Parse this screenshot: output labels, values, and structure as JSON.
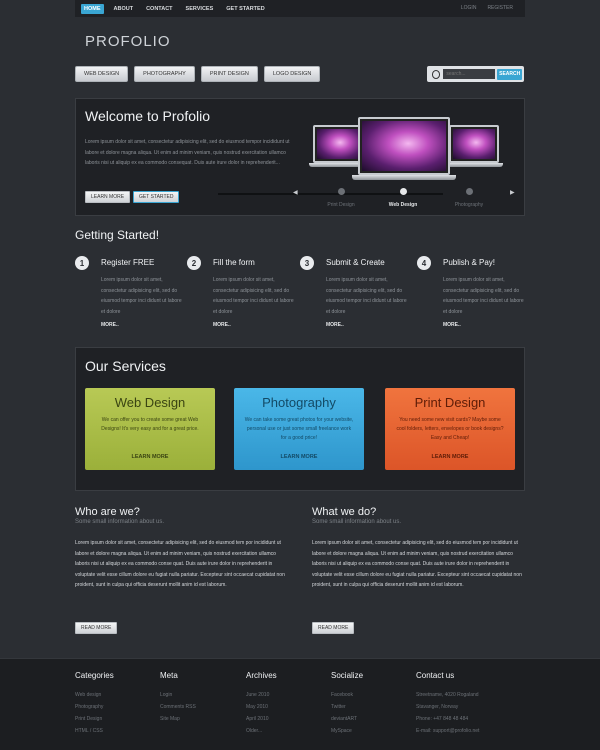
{
  "topnav": {
    "items": [
      "HOME",
      "ABOUT",
      "CONTACT",
      "SERVICES",
      "GET STARTED"
    ],
    "login": "LOGIN",
    "register": "REGISTER"
  },
  "logo": "PROFOLIO",
  "categories": [
    "WEB DESIGN",
    "PHOTOGRAPHY",
    "PRINT DESIGN",
    "LOGO DESIGN"
  ],
  "search": {
    "placeholder": "search...",
    "button": "SEARCH"
  },
  "hero": {
    "title": "Welcome to Profolio",
    "text": "Lorem ipsum dolor sit amet, consectetur adipisicing elit, sed do eiusmod tempor incididunt ut labore et dolore magna aliqua. Ut enim ad minim veniam, quis nostrud exercitation ullamco laboris nisi ut aliquip ex ea commodo consequat. Duis aute irure dolor in reprehenderit...",
    "learn_more": "LEARN MORE",
    "get_started": "GET STARTED",
    "slides": [
      "Print Design",
      "Web Design",
      "Photography"
    ],
    "active_slide": "Web Design"
  },
  "getting_started": {
    "title": "Getting Started!",
    "steps": [
      {
        "num": "1",
        "title": "Register FREE",
        "text": "Lorem ipsum dolor sit amet, consectetur adipisicing elit, sed do eiusmod tempor inci didunt ut labore et dolore",
        "more": "MORE.."
      },
      {
        "num": "2",
        "title": "Fill the form",
        "text": "Lorem ipsum dolor sit amet, consectetur adipisicing elit, sed do eiusmod tempor inci didunt ut labore et dolore",
        "more": "MORE.."
      },
      {
        "num": "3",
        "title": "Submit & Create",
        "text": "Lorem ipsum dolor sit amet, consectetur adipisicing elit, sed do eiusmod tempor inci didunt ut labore et dolore",
        "more": "MORE.."
      },
      {
        "num": "4",
        "title": "Publish & Pay!",
        "text": "Lorem ipsum dolor sit amet, consectetur adipisicing elit, sed do eiusmod tempor inci didunt ut labore et dolore",
        "more": "MORE.."
      }
    ]
  },
  "services": {
    "title": "Our Services",
    "cards": [
      {
        "title": "Web Design",
        "text": "We can offer you to create some great Web Designs! It's very easy and for a great price.",
        "more": "LEARN MORE",
        "color": "#aabd47"
      },
      {
        "title": "Photography",
        "text": "We can take some great photos for your website, personal use or just some small freelance work for a good price!",
        "more": "LEARN MORE",
        "color": "#3aa6d9"
      },
      {
        "title": "Print Design",
        "text": "You need some new visit cards? Maybe some cool folders, letters, envelopes or book designs? Easy and Cheap!",
        "more": "LEARN MORE",
        "color": "#e86433"
      }
    ]
  },
  "who": {
    "title": "Who are we?",
    "sub": "Some small information about us.",
    "text": "Lorem ipsum dolor sit amet, consectetur adipisicing elit, sed do eiusmod tem por incididunt ut labore et dolore magna aliqua. Ut enim ad minim veniam, quis nostrud exercitation ullamco laboris nisi ut aliquip ex ea commodo conse quat. Duis aute irure dolor in reprehenderit in voluptate velit esse cillum dolore eu fugiat nulla pariatur. Excepteur sint occaecat cupidatat non proident, sunt in culpa qui officia deserunt mollit anim id est laborum.",
    "button": "READ MORE"
  },
  "what": {
    "title": "What we do?",
    "sub": "Some small information about us.",
    "text": "Lorem ipsum dolor sit amet, consectetur adipisicing elit, sed do eiusmod tem por incididunt ut labore et dolore magna aliqua. Ut enim ad minim veniam, quis nostrud exercitation ullamco laboris nisi ut aliquip ex ea commodo conse quat. Duis aute irure dolor in reprehenderit in voluptate velit esse cillum dolore eu fugiat nulla pariatur. Excepteur sint occaecat cupidatat non proident, sunt in culpa qui officia deserunt mollit anim id est laborum.",
    "button": "READ MORE"
  },
  "footer": {
    "columns": [
      {
        "title": "Categories",
        "items": [
          "Web design",
          "Photography",
          "Print Design",
          "HTML / CSS"
        ]
      },
      {
        "title": "Meta",
        "items": [
          "Login",
          "Comments RSS",
          "Site Map"
        ]
      },
      {
        "title": "Archives",
        "items": [
          "June 2010",
          "May 2010",
          "April 2010",
          "Older..."
        ]
      },
      {
        "title": "Socialize",
        "items": [
          "Facebook",
          "Twitter",
          "deviantART",
          "MySpace"
        ]
      },
      {
        "title": "Contact us",
        "items": [
          "Streetname, 4020 Rogaland",
          "Stavanger, Norway",
          "Phone: +47 848 48 484",
          "E-mail: support@profolio.net"
        ]
      }
    ]
  },
  "colors": {
    "accent": "#3aa6d3",
    "background": "#2b2e33",
    "panel": "#1f2125"
  }
}
